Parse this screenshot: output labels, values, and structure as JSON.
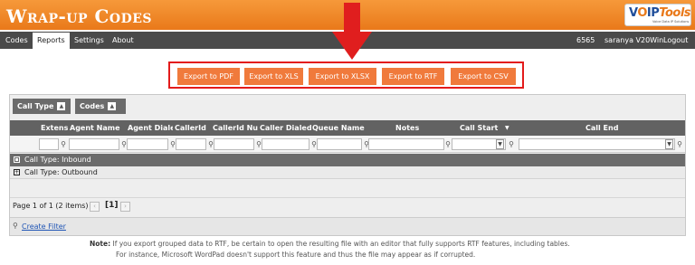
{
  "app": {
    "title": "Wrap-up Codes",
    "logo": {
      "brand_left": "V",
      "brand_o": "O",
      "brand_right": "IP",
      "brand_tools": "Tools",
      "subtitle": "Voice Data IP Solutions"
    }
  },
  "nav": {
    "items": [
      {
        "label": "Codes",
        "active": false
      },
      {
        "label": "Reports",
        "active": true
      },
      {
        "label": "Settings",
        "active": false
      },
      {
        "label": "About",
        "active": false
      }
    ],
    "right": {
      "extension": "6565",
      "user": "saranya V20Win",
      "logout": "Logout"
    }
  },
  "export": {
    "buttons": [
      "Export to PDF",
      "Export to XLS",
      "Export to XLSX",
      "Export to RTF",
      "Export to CSV"
    ],
    "accent": "#f07a3c",
    "highlight": "#e31b1b"
  },
  "grid": {
    "group_chips": [
      "Call Type",
      "Codes"
    ],
    "columns": [
      "Extens",
      "Agent Name",
      "Agent Dialed",
      "CallerId",
      "CallerId Num",
      "Caller Dialed",
      "Queue Name",
      "Notes",
      "Call Start",
      "Call End"
    ],
    "groups": [
      {
        "label": "Call Type: Inbound",
        "toggle": "▪"
      },
      {
        "label": "Call Type: Outbound",
        "toggle": "+"
      }
    ],
    "pager": {
      "text": "Page 1 of 1 (2 items)",
      "current": "[1]"
    },
    "create_filter": "Create Filter"
  },
  "note": {
    "label": "Note:",
    "line1": "If you export grouped data to RTF, be certain to open the resulting file with an editor that fully supports RTF features, including tables.",
    "line2": "For instance, Microsoft WordPad doesn't support this feature and thus the file may appear as if corrupted."
  }
}
